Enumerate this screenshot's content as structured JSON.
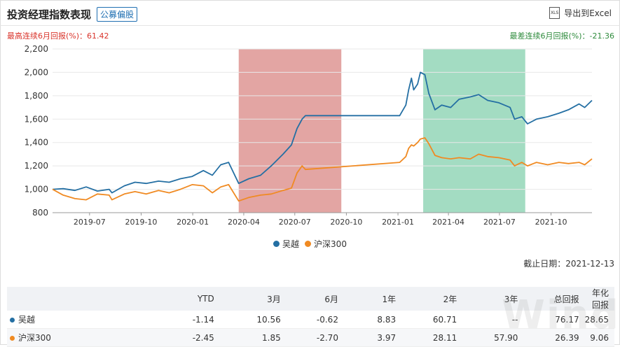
{
  "header": {
    "title": "投资经理指数表现",
    "tag": "公募偏股",
    "export_label": "导出到Excel",
    "export_icon": "excel-export-icon"
  },
  "stats": {
    "best": "最高连续6月回报(%)：61.42",
    "worst": "最差连续6月回报(%)：-21.36"
  },
  "chart_data": {
    "type": "line",
    "y_ticks": [
      "2,200",
      "2,000",
      "1,800",
      "1,600",
      "1,400",
      "1,200",
      "1,000",
      "800"
    ],
    "ylim": [
      800,
      2200
    ],
    "x_ticks": [
      "2019-07",
      "2019-10",
      "2020-01",
      "2020-04",
      "2020-07",
      "2020-10",
      "2021-01",
      "2021-04",
      "2021-07",
      "2021-10"
    ],
    "x_tick_dates": [
      "2019-07-01",
      "2019-10-01",
      "2020-01-01",
      "2020-04-01",
      "2020-07-01",
      "2020-10-01",
      "2021-01-01",
      "2021-04-01",
      "2021-07-01",
      "2021-10-01"
    ],
    "xlim": [
      "2019-04-26",
      "2021-12-13"
    ],
    "highlight_periods": [
      {
        "start": "2020-03-23",
        "end": "2020-09-22",
        "color": "#e3a5a3"
      },
      {
        "start": "2021-02-15",
        "end": "2021-08-16",
        "color": "#a3dcc2"
      }
    ],
    "series": [
      {
        "name": "吴越",
        "color": "#246fa3",
        "points": [
          [
            "2019-04-26",
            1000
          ],
          [
            "2019-05-15",
            1005
          ],
          [
            "2019-06-05",
            990
          ],
          [
            "2019-06-25",
            1020
          ],
          [
            "2019-07-15",
            985
          ],
          [
            "2019-08-05",
            1000
          ],
          [
            "2019-08-10",
            970
          ],
          [
            "2019-09-01",
            1030
          ],
          [
            "2019-09-20",
            1060
          ],
          [
            "2019-10-10",
            1050
          ],
          [
            "2019-11-01",
            1070
          ],
          [
            "2019-11-20",
            1060
          ],
          [
            "2019-12-10",
            1090
          ],
          [
            "2019-12-31",
            1110
          ],
          [
            "2020-01-20",
            1160
          ],
          [
            "2020-02-05",
            1120
          ],
          [
            "2020-02-20",
            1210
          ],
          [
            "2020-03-05",
            1230
          ],
          [
            "2020-03-23",
            1050
          ],
          [
            "2020-04-10",
            1090
          ],
          [
            "2020-05-01",
            1120
          ],
          [
            "2020-05-20",
            1200
          ],
          [
            "2020-06-10",
            1300
          ],
          [
            "2020-06-25",
            1380
          ],
          [
            "2020-07-05",
            1520
          ],
          [
            "2020-07-14",
            1600
          ],
          [
            "2020-07-20",
            1630
          ],
          [
            "2021-01-04",
            1630
          ],
          [
            "2021-01-15",
            1720
          ],
          [
            "2021-01-20",
            1850
          ],
          [
            "2021-01-25",
            1950
          ],
          [
            "2021-01-29",
            1850
          ],
          [
            "2021-02-05",
            1900
          ],
          [
            "2021-02-10",
            2000
          ],
          [
            "2021-02-18",
            1980
          ],
          [
            "2021-02-25",
            1820
          ],
          [
            "2021-03-08",
            1680
          ],
          [
            "2021-03-20",
            1720
          ],
          [
            "2021-04-05",
            1700
          ],
          [
            "2021-04-20",
            1770
          ],
          [
            "2021-05-10",
            1790
          ],
          [
            "2021-05-25",
            1810
          ],
          [
            "2021-06-10",
            1760
          ],
          [
            "2021-06-30",
            1740
          ],
          [
            "2021-07-20",
            1700
          ],
          [
            "2021-07-28",
            1600
          ],
          [
            "2021-08-10",
            1620
          ],
          [
            "2021-08-20",
            1560
          ],
          [
            "2021-09-05",
            1600
          ],
          [
            "2021-09-25",
            1620
          ],
          [
            "2021-10-15",
            1650
          ],
          [
            "2021-11-01",
            1680
          ],
          [
            "2021-11-20",
            1730
          ],
          [
            "2021-11-30",
            1700
          ],
          [
            "2021-12-13",
            1760
          ]
        ]
      },
      {
        "name": "沪深300",
        "color": "#f08a22",
        "points": [
          [
            "2019-04-26",
            1000
          ],
          [
            "2019-05-15",
            950
          ],
          [
            "2019-06-05",
            920
          ],
          [
            "2019-06-25",
            910
          ],
          [
            "2019-07-15",
            960
          ],
          [
            "2019-08-05",
            950
          ],
          [
            "2019-08-10",
            910
          ],
          [
            "2019-09-01",
            960
          ],
          [
            "2019-09-20",
            980
          ],
          [
            "2019-10-10",
            960
          ],
          [
            "2019-11-01",
            990
          ],
          [
            "2019-11-20",
            970
          ],
          [
            "2019-12-10",
            1000
          ],
          [
            "2019-12-31",
            1040
          ],
          [
            "2020-01-20",
            1030
          ],
          [
            "2020-02-05",
            970
          ],
          [
            "2020-02-20",
            1020
          ],
          [
            "2020-03-05",
            1040
          ],
          [
            "2020-03-23",
            900
          ],
          [
            "2020-04-10",
            930
          ],
          [
            "2020-05-01",
            950
          ],
          [
            "2020-05-20",
            960
          ],
          [
            "2020-06-10",
            990
          ],
          [
            "2020-06-25",
            1010
          ],
          [
            "2020-07-05",
            1140
          ],
          [
            "2020-07-14",
            1200
          ],
          [
            "2020-07-20",
            1170
          ],
          [
            "2021-01-04",
            1230
          ],
          [
            "2021-01-15",
            1280
          ],
          [
            "2021-01-20",
            1350
          ],
          [
            "2021-01-25",
            1380
          ],
          [
            "2021-01-29",
            1370
          ],
          [
            "2021-02-05",
            1400
          ],
          [
            "2021-02-10",
            1430
          ],
          [
            "2021-02-18",
            1440
          ],
          [
            "2021-02-25",
            1390
          ],
          [
            "2021-03-08",
            1290
          ],
          [
            "2021-03-20",
            1270
          ],
          [
            "2021-04-05",
            1260
          ],
          [
            "2021-04-20",
            1270
          ],
          [
            "2021-05-10",
            1260
          ],
          [
            "2021-05-25",
            1300
          ],
          [
            "2021-06-10",
            1280
          ],
          [
            "2021-06-30",
            1270
          ],
          [
            "2021-07-20",
            1250
          ],
          [
            "2021-07-28",
            1200
          ],
          [
            "2021-08-10",
            1230
          ],
          [
            "2021-08-20",
            1200
          ],
          [
            "2021-09-05",
            1230
          ],
          [
            "2021-09-25",
            1210
          ],
          [
            "2021-10-15",
            1230
          ],
          [
            "2021-11-01",
            1220
          ],
          [
            "2021-11-20",
            1230
          ],
          [
            "2021-11-30",
            1210
          ],
          [
            "2021-12-13",
            1260
          ]
        ]
      }
    ]
  },
  "legend": [
    {
      "label": "吴越",
      "color": "#246fa3"
    },
    {
      "label": "沪深300",
      "color": "#f08a22"
    }
  ],
  "deadline": "截止日期：2021-12-13",
  "table": {
    "headers": [
      "",
      "YTD",
      "3月",
      "6月",
      "1年",
      "2年",
      "3年",
      "总回报",
      "年化回报"
    ],
    "rows": [
      {
        "name": "吴越",
        "color": "#246fa3",
        "values": [
          "-1.14",
          "10.56",
          "-0.62",
          "8.83",
          "60.71",
          "--",
          "76.17",
          "28.65"
        ]
      },
      {
        "name": "沪深300",
        "color": "#f08a22",
        "values": [
          "-2.45",
          "1.85",
          "-2.70",
          "3.97",
          "28.11",
          "57.90",
          "26.39",
          "9.06"
        ]
      }
    ]
  },
  "watermark": "Wind"
}
